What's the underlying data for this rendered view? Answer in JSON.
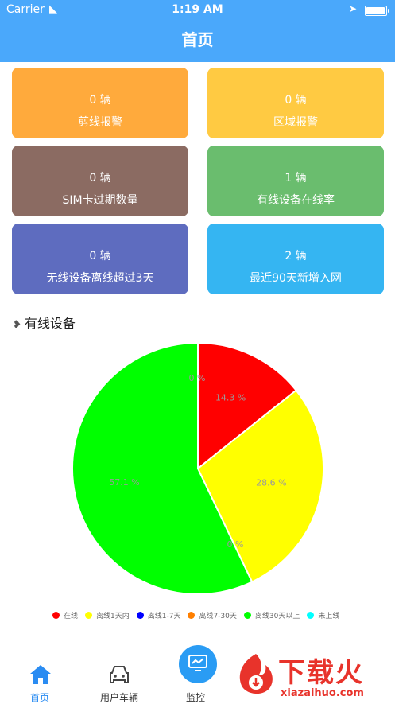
{
  "status_bar": {
    "carrier": "Carrier",
    "time": "1:19 AM",
    "battery_level": 0.95
  },
  "nav": {
    "title": "首页"
  },
  "cards": [
    {
      "count": "0 辆",
      "label": "剪线报警",
      "color": "#ffaa3c"
    },
    {
      "count": "0 辆",
      "label": "区域报警",
      "color": "#ffca42"
    },
    {
      "count": "0 辆",
      "label": "SIM卡过期数量",
      "color": "#8b6b62"
    },
    {
      "count": "1 辆",
      "label": "有线设备在线率",
      "color": "#6abd6e"
    },
    {
      "count": "0 辆",
      "label": "无线设备离线超过3天",
      "color": "#5e6cbf"
    },
    {
      "count": "2 辆",
      "label": "最近90天新增入网",
      "color": "#35b5f2"
    }
  ],
  "section": {
    "title": "有线设备"
  },
  "chart_data": {
    "type": "pie",
    "slices": [
      {
        "name": "在线",
        "value": 14.3,
        "label": "14.3 %",
        "color": "#ff0000"
      },
      {
        "name": "离线1天内",
        "value": 28.6,
        "label": "28.6 %",
        "color": "#ffff00"
      },
      {
        "name": "离线1-7天",
        "value": 0,
        "label": "0 %",
        "color": "#0000ff"
      },
      {
        "name": "离线7-30天",
        "value": 0,
        "label": "0 %",
        "color": "#ff7f00"
      },
      {
        "name": "离线30天以上",
        "value": 57.1,
        "label": "57.1 %",
        "color": "#00ff00"
      },
      {
        "name": "未上线",
        "value": 0,
        "label": "0 %",
        "color": "#00ffff"
      }
    ],
    "legend_position": "bottom"
  },
  "tabs": [
    {
      "label": "首页",
      "icon": "home-icon",
      "active": true
    },
    {
      "label": "用户车辆",
      "icon": "car-icon",
      "active": false
    },
    {
      "label": "监控",
      "icon": "monitor-icon",
      "active": false
    }
  ],
  "watermark": {
    "text": "下载火",
    "url": "xiazaihuo.com"
  }
}
